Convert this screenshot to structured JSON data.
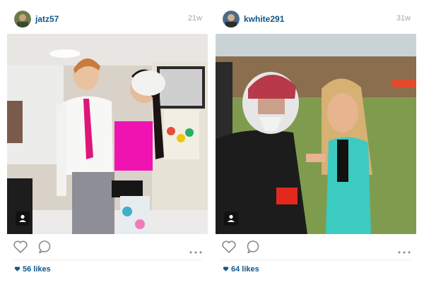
{
  "posts": [
    {
      "username": "jatz57",
      "time": "21w",
      "likes": "56 likes",
      "icons": {
        "avatar": "user-avatar",
        "like": "heart-outline-icon",
        "comment": "speech-bubble-icon",
        "more": "ellipsis-icon",
        "tagged": "person-tag-icon"
      }
    },
    {
      "username": "kwhite291",
      "time": "31w",
      "likes": "64 likes",
      "icons": {
        "avatar": "user-avatar",
        "like": "heart-outline-icon",
        "comment": "speech-bubble-icon",
        "more": "ellipsis-icon",
        "tagged": "person-tag-icon"
      }
    }
  ],
  "colors": {
    "username": "#125688",
    "timestamp": "#a5a7aa",
    "background": "#ffffff"
  }
}
